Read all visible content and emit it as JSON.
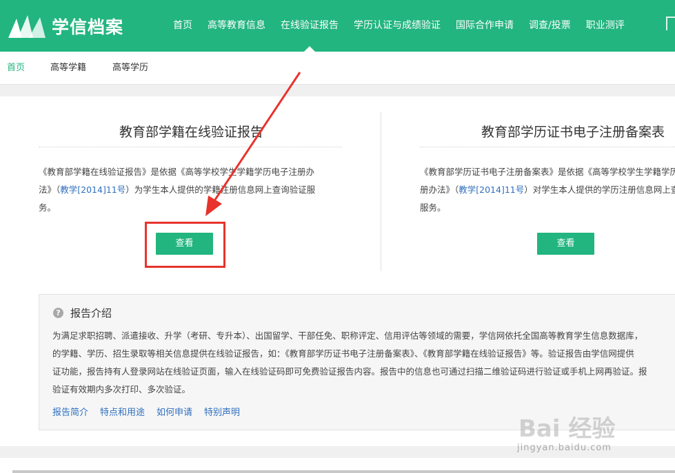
{
  "header": {
    "logo_text": "学信档案",
    "nav": [
      {
        "label": "首页"
      },
      {
        "label": "高等教育信息"
      },
      {
        "label": "在线验证报告",
        "active": true
      },
      {
        "label": "学历认证与成绩验证"
      },
      {
        "label": "国际合作申请"
      },
      {
        "label": "调查/投票"
      },
      {
        "label": "职业测评"
      }
    ]
  },
  "subnav": [
    {
      "label": "首页",
      "active": true
    },
    {
      "label": "高等学籍"
    },
    {
      "label": "高等学历"
    }
  ],
  "left_card": {
    "title": "教育部学籍在线验证报告",
    "desc_line1": "《教育部学籍在线验证报告》是依据《高等学校学生学籍学历电子注册办",
    "desc_line2_pre": "法》（",
    "desc_line2_link": "教学[2014]11号",
    "desc_line2_post": "）为学生本人提供的学籍注册信息网上查询验证服",
    "desc_line3": "务。",
    "button": "查看"
  },
  "right_card": {
    "title": "教育部学历证书电子注册备案表",
    "desc_line1": "《教育部学历证书电子注册备案表》是依据《高等学校学生学籍学历电子注",
    "desc_line2_pre": "册办法》（",
    "desc_line2_link": "教学[2014]11号",
    "desc_line2_post": "）对学生本人提供的学历注册信息网上查询验证",
    "desc_line3": "服务。",
    "button": "查看"
  },
  "report_intro": {
    "title": "报告介绍",
    "lines": [
      "为满足求职招聘、派遣接收、升学（考研、专升本）、出国留学、干部任免、职称评定、信用评估等领域的需要，学信网依托全国高等教育学生信息数据库，",
      "的学籍、学历、招生录取等相关信息提供在线验证报告，如：《教育部学历证书电子注册备案表》、《教育部学籍在线验证报告》等。验证报告由学信网提供",
      "证功能，报告持有人登录网站在线验证页面，输入在线验证码即可免费验证报告内容。报告中的信息也可通过扫描二维验证码进行验证或手机上网再验证。报",
      "验证有效期内多次打印、多次验证。"
    ],
    "links": [
      "报告简介",
      "特点和用途",
      "如何申请",
      "特别声明"
    ]
  },
  "watermark": {
    "text": "Bai 经验",
    "url": "jingyan.baidu.com"
  },
  "colors": {
    "brand": "#22b57f",
    "link": "#2f6fbe",
    "annotation": "#e8322c"
  }
}
